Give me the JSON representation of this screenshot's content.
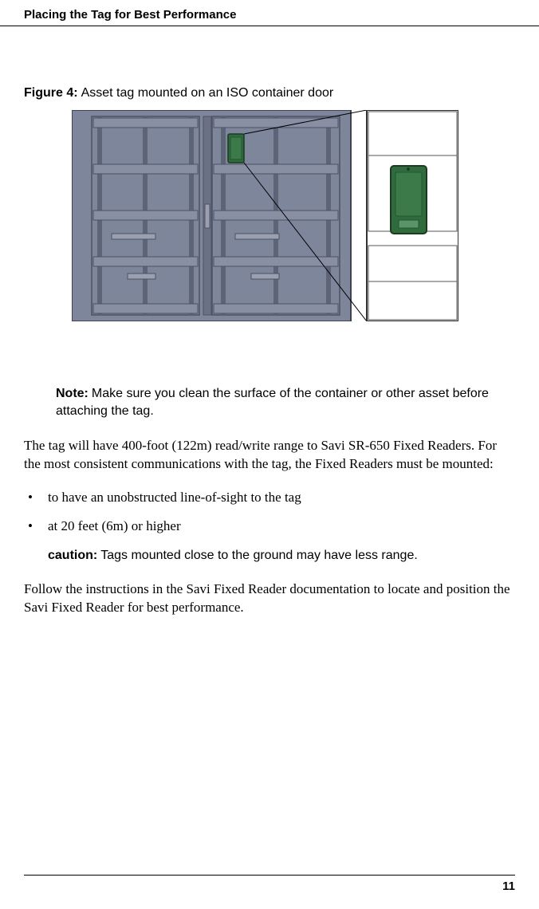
{
  "header": {
    "title": "Placing the Tag for Best Performance"
  },
  "figure": {
    "label": "Figure 4:",
    "caption": "Asset tag mounted on an ISO container door"
  },
  "note": {
    "label": "Note:",
    "text": "Make sure you clean the surface of the container or other asset before attaching the tag."
  },
  "para1": "The tag will have 400-foot (122m) read/write range to Savi SR-650 Fixed Readers. For the most consistent communications with the tag, the Fixed Readers must be mounted:",
  "bullets": [
    "to have an unobstructed line-of-sight to the tag",
    "at 20 feet (6m) or higher"
  ],
  "caution": {
    "label": "caution:",
    "text": "Tags mounted close to the ground may have less range."
  },
  "para2": "Follow the instructions in the Savi Fixed Reader documentation to locate and position the Savi Fixed Reader for best performance.",
  "footer": {
    "page": "11"
  }
}
